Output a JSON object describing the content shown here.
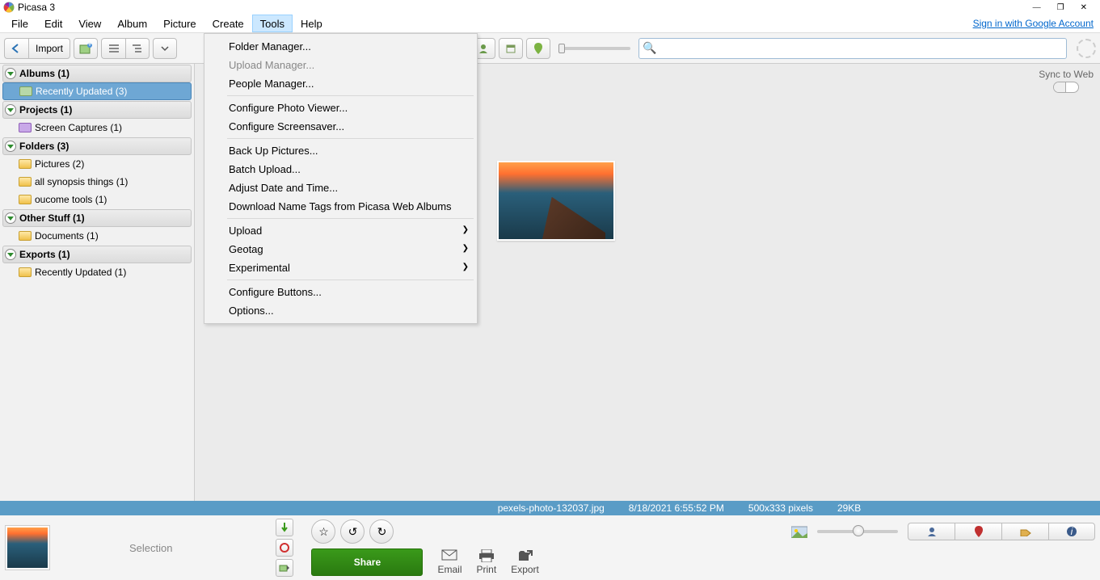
{
  "title": "Picasa 3",
  "signin": "Sign in with Google Account",
  "menu": [
    "File",
    "Edit",
    "View",
    "Album",
    "Picture",
    "Create",
    "Tools",
    "Help"
  ],
  "menu_active_index": 6,
  "dropdown": {
    "groups": [
      [
        {
          "label": "Folder Manager..."
        },
        {
          "label": "Upload Manager...",
          "disabled": true
        },
        {
          "label": "People Manager..."
        }
      ],
      [
        {
          "label": "Configure Photo Viewer..."
        },
        {
          "label": "Configure Screensaver..."
        }
      ],
      [
        {
          "label": "Back Up Pictures..."
        },
        {
          "label": "Batch Upload..."
        },
        {
          "label": "Adjust Date and Time..."
        },
        {
          "label": "Download Name Tags from Picasa Web Albums"
        }
      ],
      [
        {
          "label": "Upload",
          "submenu": true
        },
        {
          "label": "Geotag",
          "submenu": true
        },
        {
          "label": "Experimental",
          "submenu": true
        }
      ],
      [
        {
          "label": "Configure Buttons..."
        },
        {
          "label": "Options..."
        }
      ]
    ]
  },
  "toolbar": {
    "import": "Import"
  },
  "sidebar": {
    "cats": [
      {
        "title": "Albums (1)",
        "items": [
          {
            "label": "Recently Updated (3)",
            "icon": "album",
            "selected": true
          }
        ]
      },
      {
        "title": "Projects (1)",
        "items": [
          {
            "label": "Screen Captures (1)",
            "icon": "proj"
          }
        ]
      },
      {
        "title": "Folders (3)",
        "items": [
          {
            "label": "Pictures (2)",
            "icon": "folder"
          },
          {
            "label": "all synopsis things (1)",
            "icon": "folder"
          },
          {
            "label": "oucome tools (1)",
            "icon": "folder"
          }
        ]
      },
      {
        "title": "Other Stuff (1)",
        "items": [
          {
            "label": "Documents (1)",
            "icon": "folder"
          }
        ]
      },
      {
        "title": "Exports (1)",
        "items": [
          {
            "label": "Recently Updated (1)",
            "icon": "folder"
          }
        ]
      }
    ]
  },
  "sync_label": "Sync to Web",
  "info": {
    "filename": "pexels-photo-132037.jpg",
    "datetime": "8/18/2021 6:55:52 PM",
    "dims": "500x333 pixels",
    "size": "29KB"
  },
  "bottom": {
    "selection": "Selection",
    "share": "Share",
    "email": "Email",
    "print": "Print",
    "export": "Export"
  }
}
